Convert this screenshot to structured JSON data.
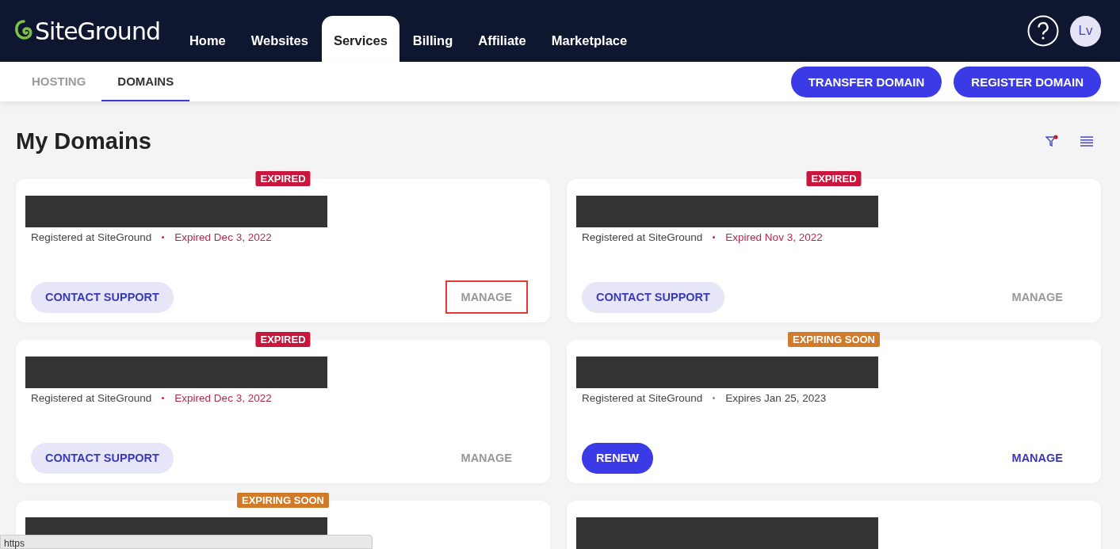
{
  "header": {
    "logo": "SiteGround",
    "nav": [
      {
        "label": "Home",
        "selected": false
      },
      {
        "label": "Websites",
        "selected": false
      },
      {
        "label": "Services",
        "selected": true
      },
      {
        "label": "Billing",
        "selected": false
      },
      {
        "label": "Affiliate",
        "selected": false
      },
      {
        "label": "Marketplace",
        "selected": false
      }
    ],
    "avatar": "Lv"
  },
  "subnav": {
    "tabs": [
      {
        "label": "HOSTING",
        "selected": false
      },
      {
        "label": "DOMAINS",
        "selected": true
      }
    ],
    "buttons": [
      "TRANSFER DOMAIN",
      "REGISTER DOMAIN"
    ]
  },
  "page": {
    "title": "My Domains",
    "filter_active": true
  },
  "cards": [
    {
      "badge": {
        "kind": "expired",
        "label": "EXPIRED"
      },
      "registrar": "Registered at SiteGround",
      "expiry": {
        "kind": "expired",
        "label": "Expired Dec 3, 2022"
      },
      "action": {
        "kind": "secondary",
        "label": "CONTACT SUPPORT"
      },
      "manage": {
        "label": "MANAGE",
        "disabled": true,
        "highlighted": true
      }
    },
    {
      "badge": {
        "kind": "expired",
        "label": "EXPIRED"
      },
      "registrar": "Registered at SiteGround",
      "expiry": {
        "kind": "expired",
        "label": "Expired Nov 3, 2022"
      },
      "action": {
        "kind": "secondary",
        "label": "CONTACT SUPPORT"
      },
      "manage": {
        "label": "MANAGE",
        "disabled": true,
        "highlighted": false
      }
    },
    {
      "badge": {
        "kind": "expired",
        "label": "EXPIRED"
      },
      "registrar": "Registered at SiteGround",
      "expiry": {
        "kind": "expired",
        "label": "Expired Dec 3, 2022"
      },
      "action": {
        "kind": "secondary",
        "label": "CONTACT SUPPORT"
      },
      "manage": {
        "label": "MANAGE",
        "disabled": true,
        "highlighted": false
      }
    },
    {
      "badge": {
        "kind": "expiring",
        "label": "EXPIRING SOON"
      },
      "registrar": "Registered at SiteGround",
      "expiry": {
        "kind": "active",
        "label": "Expires Jan 25, 2023"
      },
      "action": {
        "kind": "primary",
        "label": "RENEW"
      },
      "manage": {
        "label": "MANAGE",
        "disabled": false,
        "highlighted": false
      }
    },
    {
      "badge": {
        "kind": "expiring",
        "label": "EXPIRING SOON"
      },
      "redacted": true
    },
    {
      "redacted": true
    }
  ],
  "status_bar": {
    "url": "https"
  }
}
